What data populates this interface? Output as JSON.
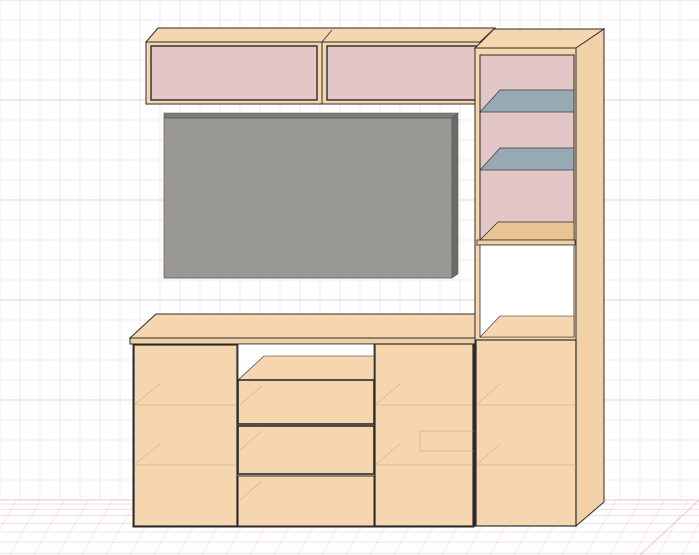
{
  "scene": {
    "view": "3d-furniture-preview",
    "grid_on": true,
    "objects": [
      {
        "name": "left-wall-cabinet",
        "kind": "wall-cabinet"
      },
      {
        "name": "right-wall-cabinet",
        "kind": "wall-cabinet"
      },
      {
        "name": "tv-screen",
        "kind": "tv-panel"
      },
      {
        "name": "tv-stand",
        "kind": "base-unit"
      },
      {
        "name": "tall-shelf-unit",
        "kind": "tall-cabinet"
      }
    ]
  },
  "colors": {
    "background": "#ffffff",
    "grid_line": "#e6a9b0",
    "wood": "#f5d6ae",
    "wood_dark": "#e9c393",
    "wood_edge": "#2b2b2b",
    "cabinet_interior": "#e3c6c6",
    "tv_panel": "#979794",
    "tv_side": "#6b6b69",
    "glass_shelf": "#8fa6b2",
    "floor_grid": "#e8a8b2"
  }
}
